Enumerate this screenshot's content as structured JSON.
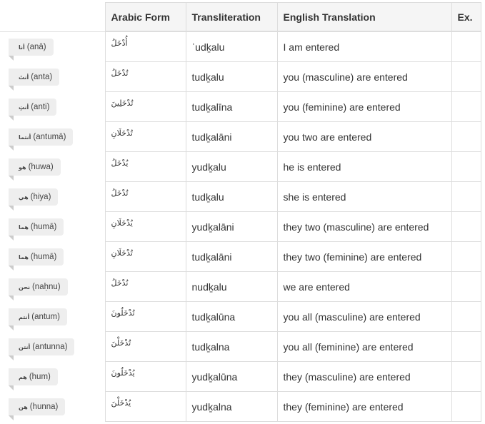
{
  "headers": {
    "arabic_form": "Arabic Form",
    "transliteration": "Transliteration",
    "english_translation": "English Translation",
    "ex": "Ex."
  },
  "rows": [
    {
      "pronoun_ar": "أنا",
      "pronoun_tr": "(anā)",
      "arabic": "أُدْخَلُ",
      "translit": "ʾudḵalu",
      "english": "I am entered"
    },
    {
      "pronoun_ar": "أنتَ",
      "pronoun_tr": "(anta)",
      "arabic": "تُدْخَلُ",
      "translit": "tudḵalu",
      "english": "you (masculine) are entered"
    },
    {
      "pronoun_ar": "أنتِ",
      "pronoun_tr": "(anti)",
      "arabic": "تُدْخَلِينَ",
      "translit": "tudḵalīna",
      "english": "you (feminine) are entered"
    },
    {
      "pronoun_ar": "أنتما",
      "pronoun_tr": "(antumā)",
      "arabic": "تُدْخَلَانِ",
      "translit": "tudḵalāni",
      "english": "you two are entered"
    },
    {
      "pronoun_ar": "هو",
      "pronoun_tr": "(huwa)",
      "arabic": "يُدْخَلُ",
      "translit": "yudḵalu",
      "english": "he is entered"
    },
    {
      "pronoun_ar": "هي",
      "pronoun_tr": "(hiya)",
      "arabic": "تُدْخَلُ",
      "translit": "tudḵalu",
      "english": "she is entered"
    },
    {
      "pronoun_ar": "هما",
      "pronoun_tr": "(humā)",
      "arabic": "يُدْخَلَانِ",
      "translit": "yudḵalāni",
      "english": "they two (masculine) are entered"
    },
    {
      "pronoun_ar": "هما",
      "pronoun_tr": "(humā)",
      "arabic": "تُدْخَلَانِ",
      "translit": "tudḵalāni",
      "english": "they two (feminine) are entered"
    },
    {
      "pronoun_ar": "نحن",
      "pronoun_tr": "(naḥnu)",
      "arabic": "نُدْخَلُ",
      "translit": "nudḵalu",
      "english": "we are entered"
    },
    {
      "pronoun_ar": "أنتم",
      "pronoun_tr": "(antum)",
      "arabic": "تُدْخَلُونَ",
      "translit": "tudḵalūna",
      "english": "you all (masculine) are entered"
    },
    {
      "pronoun_ar": "أنتن",
      "pronoun_tr": "(antunna)",
      "arabic": "تُدْخَلْنَ",
      "translit": "tudḵalna",
      "english": "you all (feminine) are entered"
    },
    {
      "pronoun_ar": "هم",
      "pronoun_tr": "(hum)",
      "arabic": "يُدْخَلُونَ",
      "translit": "yudḵalūna",
      "english": "they (masculine) are entered"
    },
    {
      "pronoun_ar": "هن",
      "pronoun_tr": "(hunna)",
      "arabic": "يُدْخَلْنَ",
      "translit": "yudḵalna",
      "english": "they (feminine) are entered"
    }
  ]
}
